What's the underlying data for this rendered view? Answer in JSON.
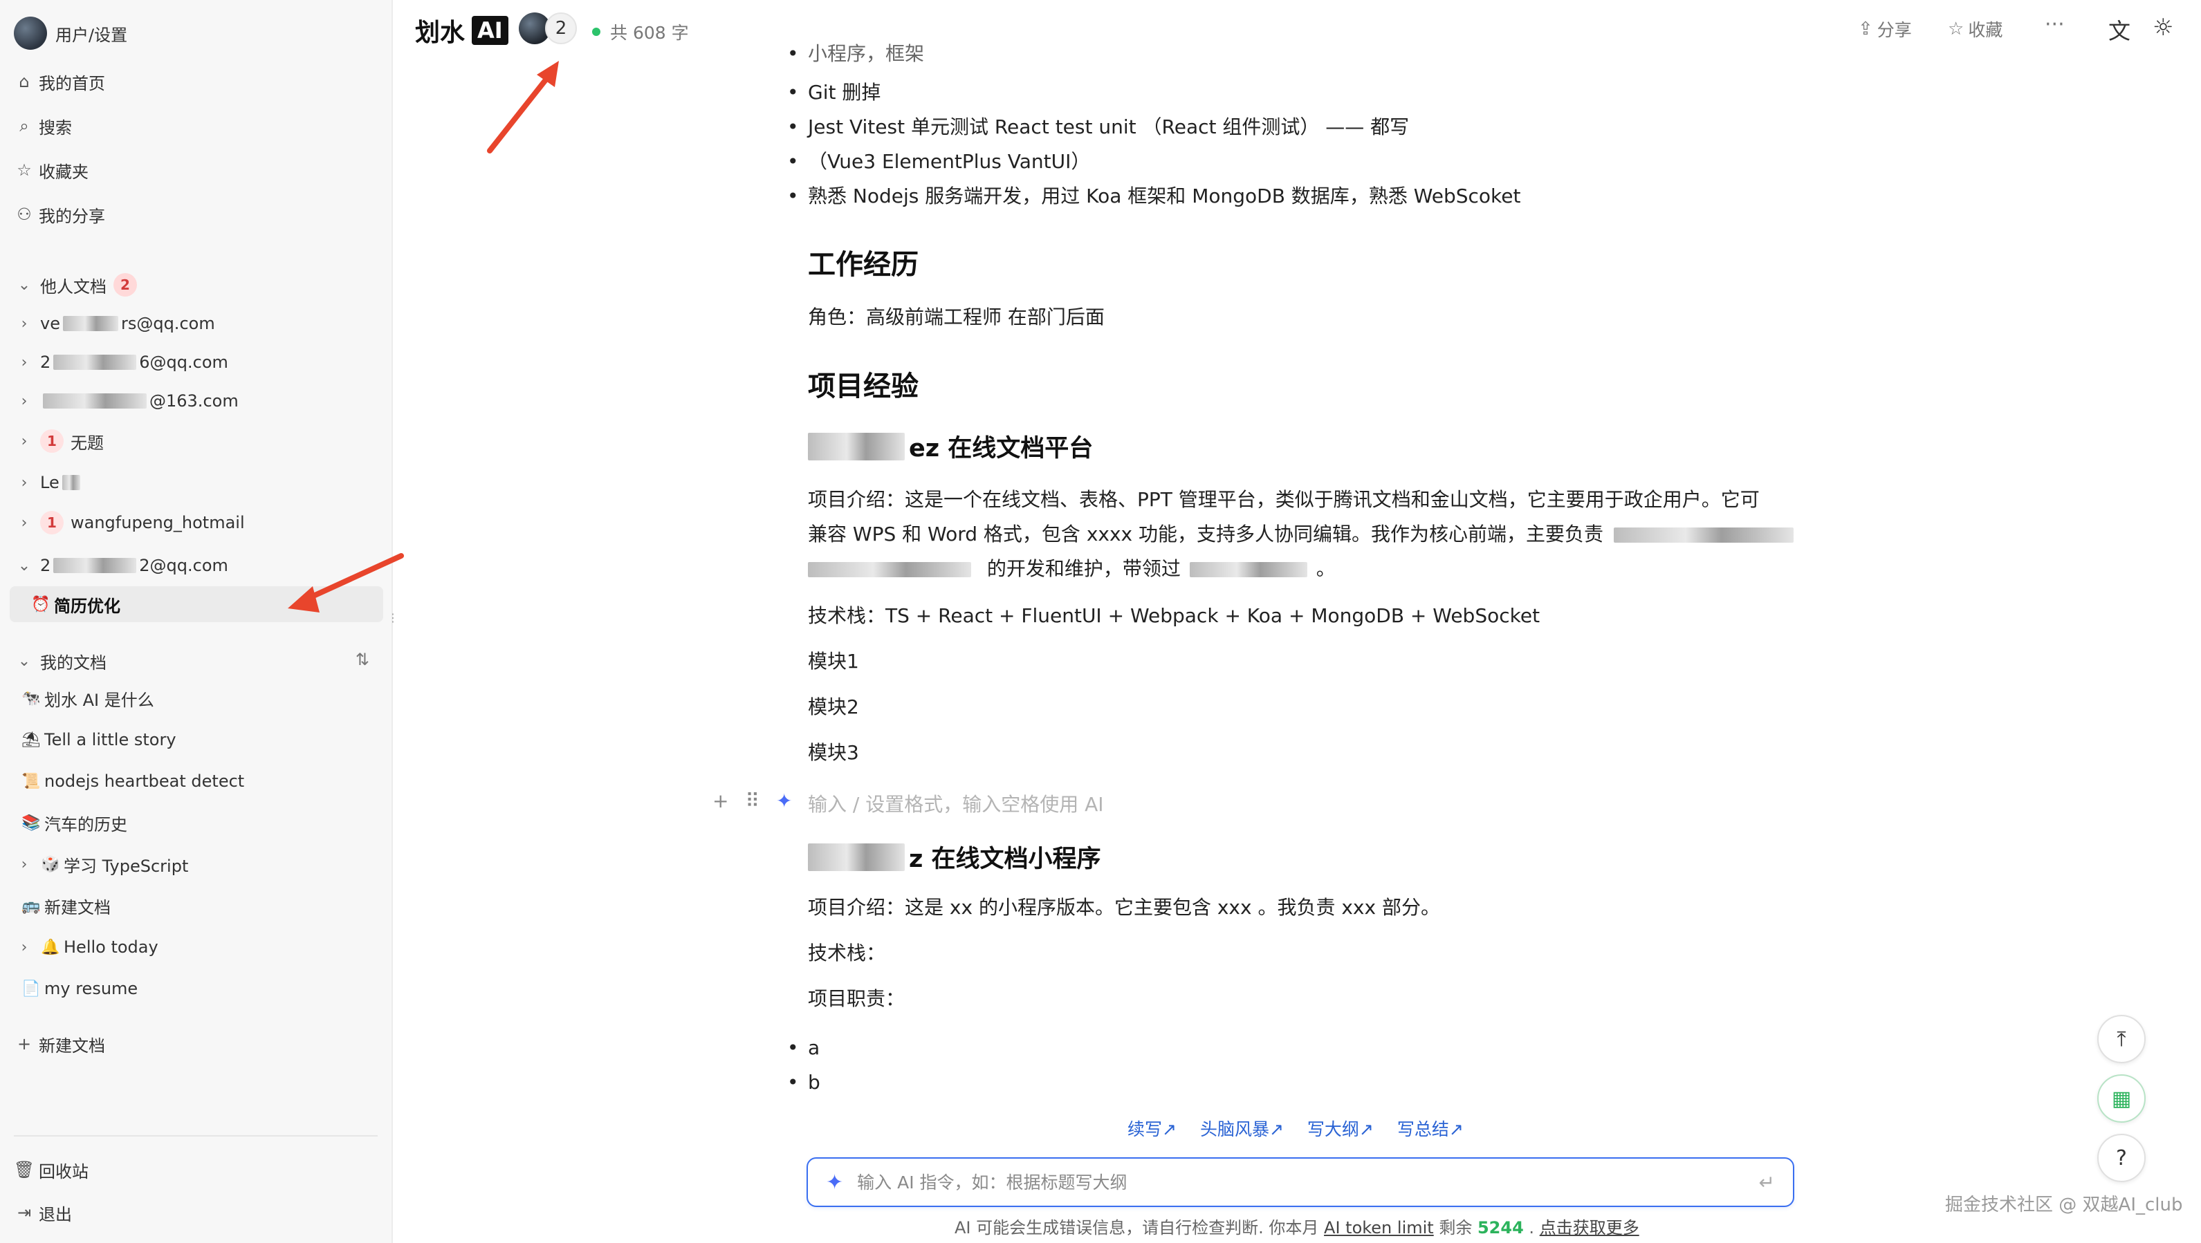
{
  "sidebar": {
    "user_label": "用户/设置",
    "nav": [
      {
        "icon": "home-icon",
        "glyph": "⌂",
        "label": "我的首页"
      },
      {
        "icon": "search-icon",
        "glyph": "⌕",
        "label": "搜索"
      },
      {
        "icon": "star-icon",
        "glyph": "☆",
        "label": "收藏夹"
      },
      {
        "icon": "users-icon",
        "glyph": "⚇",
        "label": "我的分享"
      }
    ],
    "others_section": {
      "label": "他人文档",
      "badge": "2"
    },
    "others_items": [
      {
        "prefix": "ve",
        "suffix": "rs@qq.com"
      },
      {
        "prefix": "2",
        "suffix": "6@qq.com"
      },
      {
        "prefix": "",
        "suffix": "@163.com"
      },
      {
        "badge": "1",
        "label": "无题"
      },
      {
        "prefix": "Le",
        "suffix": ""
      },
      {
        "badge": "1",
        "label": "wangfupeng_hotmail"
      },
      {
        "prefix": "2",
        "suffix": "2@qq.com"
      }
    ],
    "active_doc": {
      "emoji": "⏰",
      "label": "简历优化"
    },
    "mine_section": {
      "label": "我的文档"
    },
    "mine_items": [
      {
        "emoji": "🐄",
        "label": "划水 AI 是什么"
      },
      {
        "emoji": "⛱",
        "label": "Tell a little story"
      },
      {
        "emoji": "📜",
        "label": "nodejs heartbeat detect"
      },
      {
        "emoji": "📚",
        "label": "汽车的历史"
      },
      {
        "emoji": "🎲",
        "label": "学习 TypeScript",
        "expandable": true
      },
      {
        "emoji": "🚌",
        "label": "新建文档"
      },
      {
        "emoji": "🔔",
        "label": "Hello today",
        "expandable": true
      },
      {
        "emoji": "📄",
        "label": "my resume"
      }
    ],
    "new_doc": "新建文档",
    "trash": "回收站",
    "logout": "退出"
  },
  "topbar": {
    "brand": "划水",
    "brand_ai": "AI",
    "collaborators": "2",
    "word_count": "共 608 字",
    "share": "分享",
    "favorite": "收藏",
    "more": "···"
  },
  "doc": {
    "top_cut": "小程序，框架",
    "bullets_top": [
      "Git 删掉",
      "Jest Vitest 单元测试 React test unit （React 组件测试） —— 都写",
      "（Vue3 ElementPlus VantUI）",
      "熟悉 Nodejs 服务端开发，用过 Koa 框架和 MongoDB 数据库，熟悉 WebScoket"
    ],
    "h_work": "工作经历",
    "role": "角色：高级前端工程师 在部门后面",
    "h_project": "项目经验",
    "proj1_title": "ez 在线文档平台",
    "proj1_desc1": "项目介绍：这是一个在线文档、表格、PPT 管理平台，类似于腾讯文档和金山文档，它主要用于政企用户。它可",
    "proj1_desc2": "兼容 WPS 和 Word 格式，包含 xxxx 功能，支持多人协同编辑。我作为核心前端，主要负责",
    "proj1_desc3a": "的开发和维护，带领过",
    "proj1_desc3b": "。",
    "proj1_stack": "技术栈：TS + React + FluentUI + Webpack + Koa + MongoDB + WebSocket",
    "modules": [
      "模块1",
      "模块2",
      "模块3"
    ],
    "placeholder": "输入 / 设置格式，输入空格使用 AI",
    "proj2_title": "z 在线文档小程序",
    "proj2_desc": "项目介绍：这是 xx 的小程序版本。它主要包含 xxx 。我负责 xxx 部分。",
    "proj2_stack": "技术栈：",
    "proj2_duty": "项目职责：",
    "bullets_bottom": [
      "a",
      "b"
    ]
  },
  "ai": {
    "suggestions": [
      "续写↗",
      "头脑风暴↗",
      "写大纲↗",
      "写总结↗"
    ],
    "input_placeholder": "输入 AI 指令，如：根据标题写大纲",
    "note_prefix": "AI 可能会生成错误信息，请自行检查判断. 你本月",
    "note_link": "AI token limit",
    "note_mid": "剩余",
    "note_num": "5244",
    "note_sep": ".",
    "note_more": "点击获取更多"
  },
  "watermark": "掘金技术社区 @ 双越AI_club",
  "colors": {
    "accent": "#3a6ff0",
    "badge_bg": "#ffd9d9",
    "badge_fg": "#d23b3b",
    "arrow": "#e8452c",
    "online": "#2cc36b"
  }
}
